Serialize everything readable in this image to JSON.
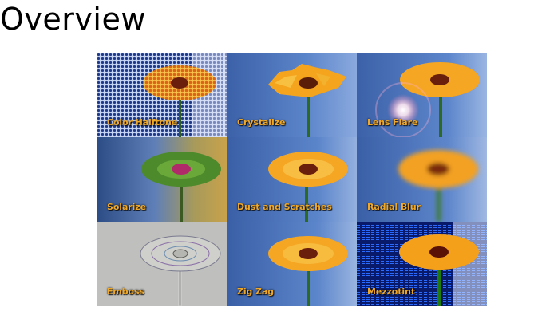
{
  "page": {
    "title": "Overview"
  },
  "filters": [
    {
      "label": "Color Halftone"
    },
    {
      "label": "Crystalize"
    },
    {
      "label": "Lens Flare"
    },
    {
      "label": "Solarize"
    },
    {
      "label": "Dust and Scratches"
    },
    {
      "label": "Radial Blur"
    },
    {
      "label": "Emboss"
    },
    {
      "label": "Zig Zag"
    },
    {
      "label": "Mezzotint"
    }
  ],
  "colors": {
    "label_text": "#f0a828",
    "sky_blue": "#4a6fb8",
    "petal_orange": "#f5a623",
    "stem_green": "#3e7a2a"
  }
}
